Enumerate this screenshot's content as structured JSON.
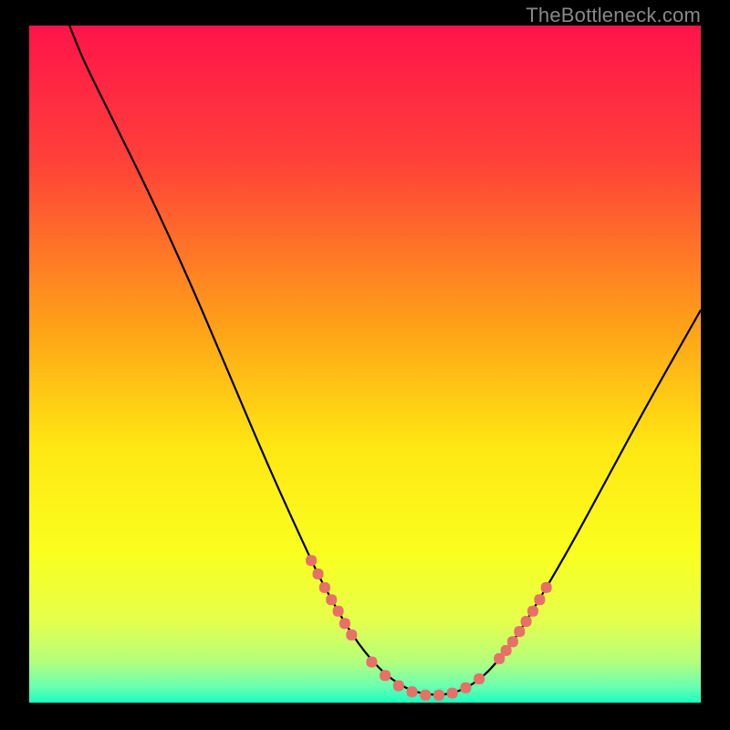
{
  "watermark": "TheBottleneck.com",
  "chart_data": {
    "type": "line",
    "title": "",
    "xlabel": "",
    "ylabel": "",
    "xlim": [
      0,
      100
    ],
    "ylim": [
      0,
      100
    ],
    "grid": false,
    "legend": false,
    "gradient_stops": [
      {
        "pos": 0.0,
        "color": "#ff144b"
      },
      {
        "pos": 0.2,
        "color": "#ff4139"
      },
      {
        "pos": 0.45,
        "color": "#ffa418"
      },
      {
        "pos": 0.62,
        "color": "#ffe713"
      },
      {
        "pos": 0.78,
        "color": "#faff1f"
      },
      {
        "pos": 0.88,
        "color": "#e5ff4d"
      },
      {
        "pos": 0.94,
        "color": "#b3ff7e"
      },
      {
        "pos": 0.975,
        "color": "#6dffb1"
      },
      {
        "pos": 1.0,
        "color": "#1bffbf"
      }
    ],
    "series": [
      {
        "name": "bottleneck-curve",
        "color": "#000000",
        "points": [
          {
            "x": 6.0,
            "y": 100.0
          },
          {
            "x": 8.0,
            "y": 95.0
          },
          {
            "x": 12.0,
            "y": 87.0
          },
          {
            "x": 18.0,
            "y": 75.0
          },
          {
            "x": 24.0,
            "y": 62.0
          },
          {
            "x": 30.0,
            "y": 48.0
          },
          {
            "x": 36.0,
            "y": 34.0
          },
          {
            "x": 42.0,
            "y": 21.0
          },
          {
            "x": 44.0,
            "y": 17.0
          },
          {
            "x": 48.0,
            "y": 10.0
          },
          {
            "x": 52.0,
            "y": 5.0
          },
          {
            "x": 56.0,
            "y": 2.0
          },
          {
            "x": 60.0,
            "y": 1.0
          },
          {
            "x": 64.0,
            "y": 1.5
          },
          {
            "x": 68.0,
            "y": 4.0
          },
          {
            "x": 72.0,
            "y": 9.0
          },
          {
            "x": 74.0,
            "y": 12.0
          },
          {
            "x": 80.0,
            "y": 22.0
          },
          {
            "x": 86.0,
            "y": 33.0
          },
          {
            "x": 92.0,
            "y": 44.0
          },
          {
            "x": 100.0,
            "y": 58.0
          }
        ]
      }
    ],
    "markers": {
      "name": "dotted-segments",
      "color": "#e77068",
      "points": [
        {
          "x": 42.0,
          "y": 21.0
        },
        {
          "x": 43.0,
          "y": 19.0
        },
        {
          "x": 44.0,
          "y": 17.0
        },
        {
          "x": 45.0,
          "y": 15.2
        },
        {
          "x": 46.0,
          "y": 13.5
        },
        {
          "x": 47.0,
          "y": 11.7
        },
        {
          "x": 48.0,
          "y": 10.0
        },
        {
          "x": 51.0,
          "y": 6.0
        },
        {
          "x": 53.0,
          "y": 4.0
        },
        {
          "x": 55.0,
          "y": 2.5
        },
        {
          "x": 57.0,
          "y": 1.6
        },
        {
          "x": 59.0,
          "y": 1.1
        },
        {
          "x": 61.0,
          "y": 1.1
        },
        {
          "x": 63.0,
          "y": 1.4
        },
        {
          "x": 65.0,
          "y": 2.2
        },
        {
          "x": 67.0,
          "y": 3.5
        },
        {
          "x": 70.0,
          "y": 6.5
        },
        {
          "x": 71.0,
          "y": 7.7
        },
        {
          "x": 72.0,
          "y": 9.0
        },
        {
          "x": 73.0,
          "y": 10.5
        },
        {
          "x": 74.0,
          "y": 12.0
        },
        {
          "x": 75.0,
          "y": 13.5
        },
        {
          "x": 76.0,
          "y": 15.2
        },
        {
          "x": 77.0,
          "y": 17.0
        }
      ]
    }
  }
}
